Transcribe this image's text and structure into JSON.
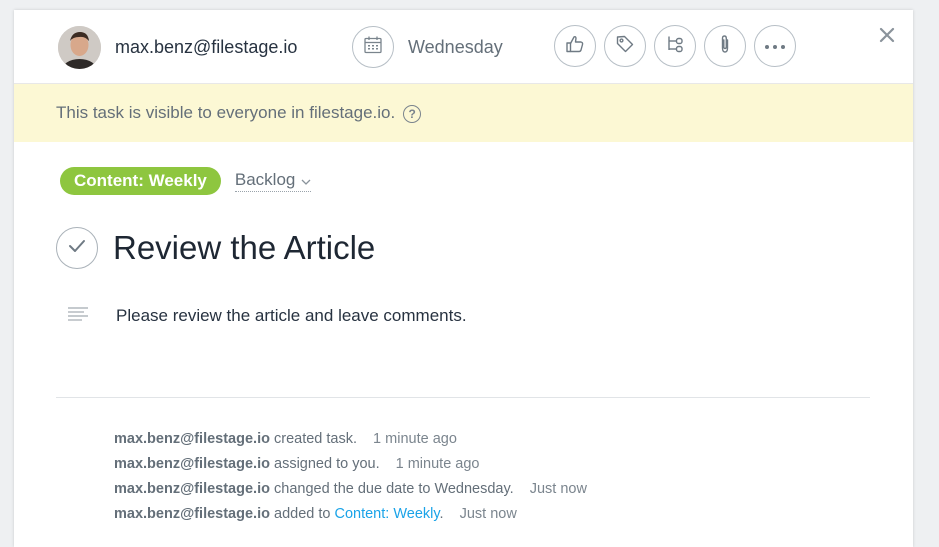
{
  "toolbar": {
    "assignee_email": "max.benz@filestage.io",
    "due_date": "Wednesday",
    "action_icons": [
      "like-icon",
      "tag-icon",
      "subtask-icon",
      "attachment-icon",
      "more-icon"
    ],
    "close_icon": "close-icon"
  },
  "banner": {
    "text": "This task is visible to everyone in filestage.io.",
    "help_glyph": "?"
  },
  "task": {
    "project": "Content: Weekly",
    "section": "Backlog",
    "title": "Review the Article",
    "description": "Please review the article and leave comments."
  },
  "stories": [
    {
      "actor": "max.benz@filestage.io",
      "action": "created task.",
      "time": "1 minute ago"
    },
    {
      "actor": "max.benz@filestage.io",
      "action": "assigned to you.",
      "time": "1 minute ago"
    },
    {
      "actor": "max.benz@filestage.io",
      "action": "changed the due date to Wednesday.",
      "time": "Just now"
    },
    {
      "actor": "max.benz@filestage.io",
      "action": "added to",
      "link": "Content: Weekly",
      "after_link": ".",
      "time": "Just now"
    }
  ],
  "colors": {
    "project_pill": "#8ec63f",
    "banner_bg": "#fcf8d4",
    "link": "#1aa3e8"
  }
}
